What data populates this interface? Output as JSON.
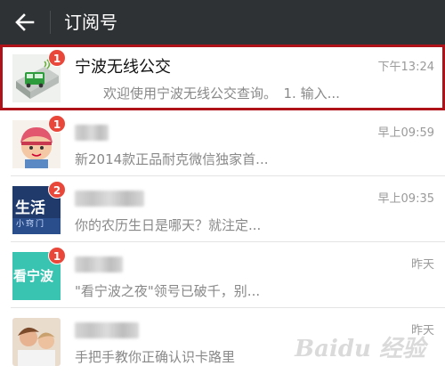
{
  "header": {
    "title": "订阅号",
    "back_icon": "arrow-left-icon",
    "background": "#2f3234"
  },
  "accent": {
    "badge": "#e8473a",
    "highlight_border": "#b0121a"
  },
  "subscriptions": [
    {
      "name": "宁波无线公交",
      "time": "下午13:24",
      "preview": "欢迎使用宁波无线公交查询。　1. 输入...",
      "badge": "1",
      "avatar_icon": "bus-icon",
      "highlighted": true
    },
    {
      "name": "",
      "time": "早上09:59",
      "preview": "新2014款正品耐克微信独家首...",
      "badge": "1",
      "avatar_icon": "cartoon-girl-avatar"
    },
    {
      "name": "",
      "time": "早上09:35",
      "preview": "你的农历生日是哪天？就注定...",
      "badge": "2",
      "avatar_icon": "life-logo-avatar",
      "avatar_text": "生活",
      "avatar_subtext": "小窍门"
    },
    {
      "name": "",
      "time": "昨天",
      "preview": "\"看宁波之夜\"领号已破千，别...",
      "badge": "1",
      "avatar_icon": "kan-ningbo-logo-avatar",
      "avatar_text": "看宁波"
    },
    {
      "name": "",
      "time": "昨天",
      "preview": "手把手教你正确认识卡路里",
      "badge": "",
      "avatar_icon": "photo-avatar"
    }
  ],
  "watermark": "Baidu 经验"
}
